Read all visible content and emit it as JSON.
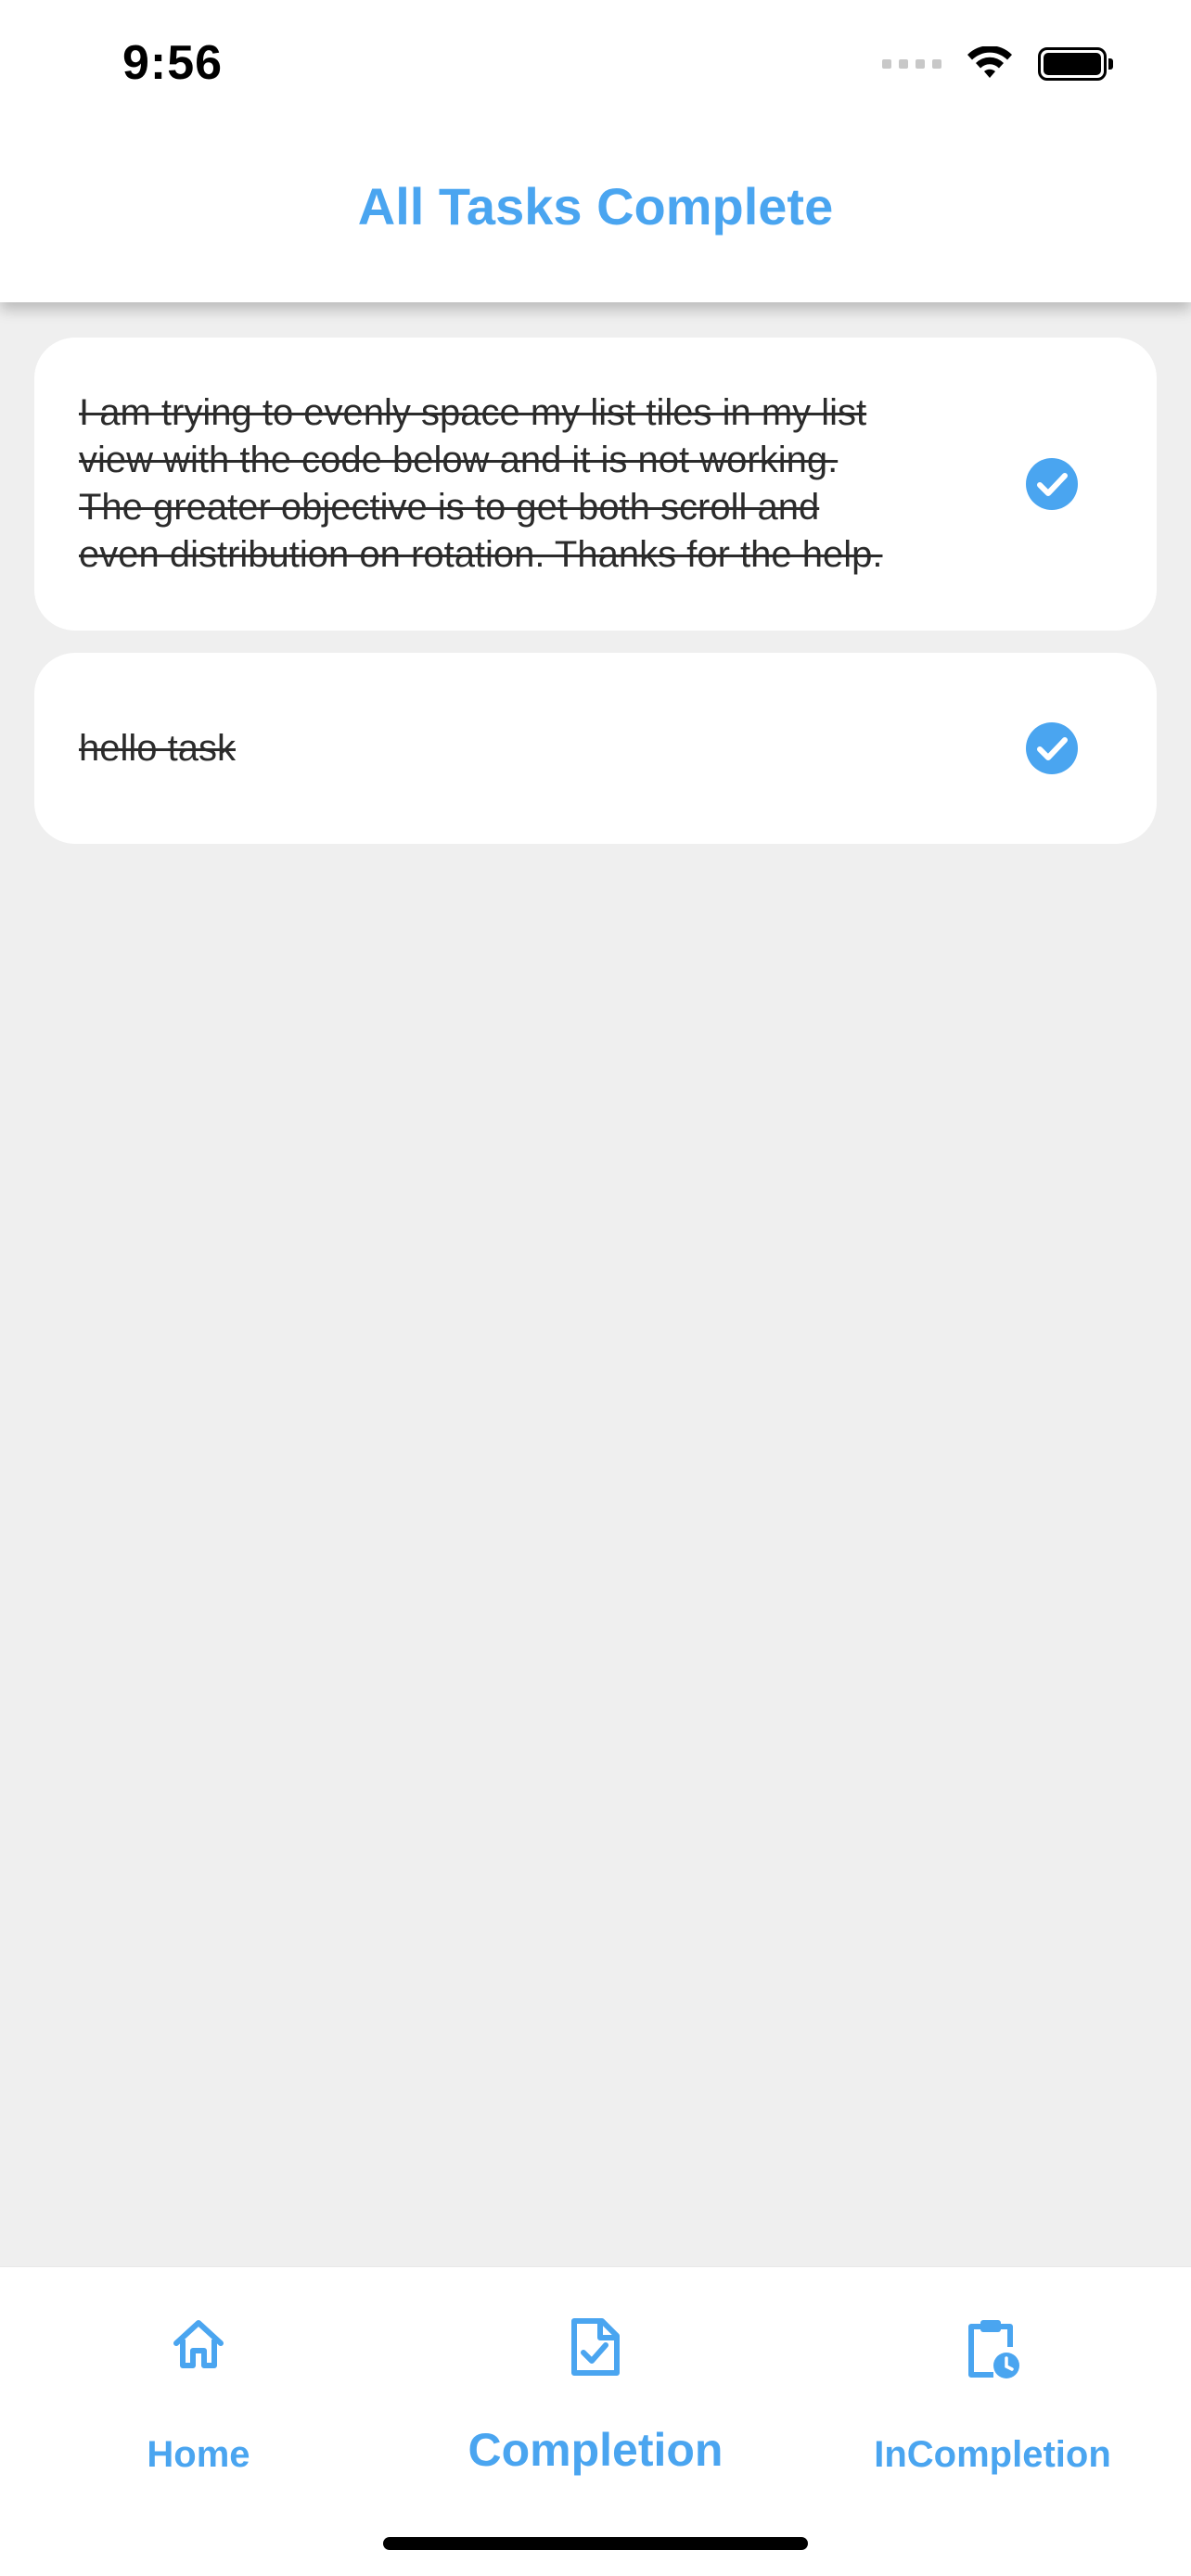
{
  "status_bar": {
    "time": "9:56"
  },
  "app_bar": {
    "title": "All Tasks Complete"
  },
  "tasks": [
    {
      "text": "I am trying to evenly space my list tiles in my list view with the code below and it is not working. The greater objective is to get both scroll and even distribution on rotation. Thanks for the help.",
      "completed": true,
      "icon": "check-circle-icon"
    },
    {
      "text": "hello task",
      "completed": true,
      "icon": "check-circle-icon"
    }
  ],
  "bottom_nav": {
    "items": [
      {
        "label": "Home",
        "icon": "home-icon"
      },
      {
        "label": "Completion",
        "icon": "document-check-icon",
        "selected": true
      },
      {
        "label": "InCompletion",
        "icon": "clipboard-clock-icon"
      }
    ]
  },
  "colors": {
    "accent": "#4aa5f0",
    "background": "#efefef",
    "card": "#ffffff",
    "text": "#2b2b2b"
  }
}
